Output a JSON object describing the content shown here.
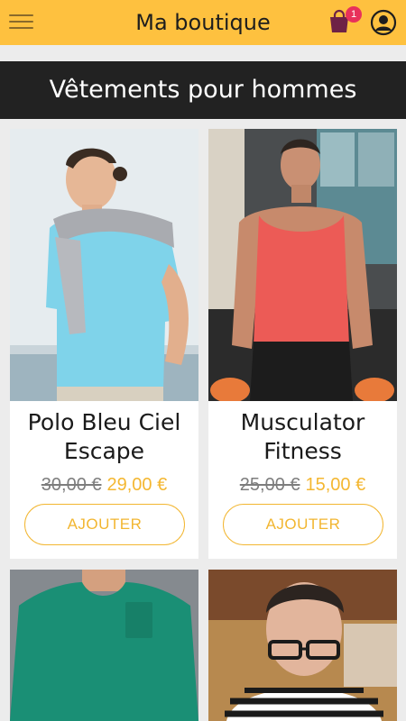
{
  "appbar": {
    "title": "Ma boutique",
    "cart_count": "1",
    "menu_icon": "hamburger-menu-icon",
    "cart_icon": "shopping-bag-icon",
    "account_icon": "user-circle-icon"
  },
  "category": {
    "title": "Vêtements pour hommes"
  },
  "products": [
    {
      "name": "Polo Bleu Ciel Escape",
      "old_price": "30,00 €",
      "price": "29,00 €",
      "button": "AJOUTER"
    },
    {
      "name": "Musculator Fitness",
      "old_price": "25,00 €",
      "price": "15,00 €",
      "button": "AJOUTER"
    },
    {
      "name": "",
      "old_price": "",
      "price": "",
      "button": ""
    },
    {
      "name": "",
      "old_price": "",
      "price": "",
      "button": ""
    }
  ],
  "colors": {
    "accent": "#fec13f",
    "banner": "#222222",
    "price": "#f4b731",
    "badge": "#e8315b"
  }
}
